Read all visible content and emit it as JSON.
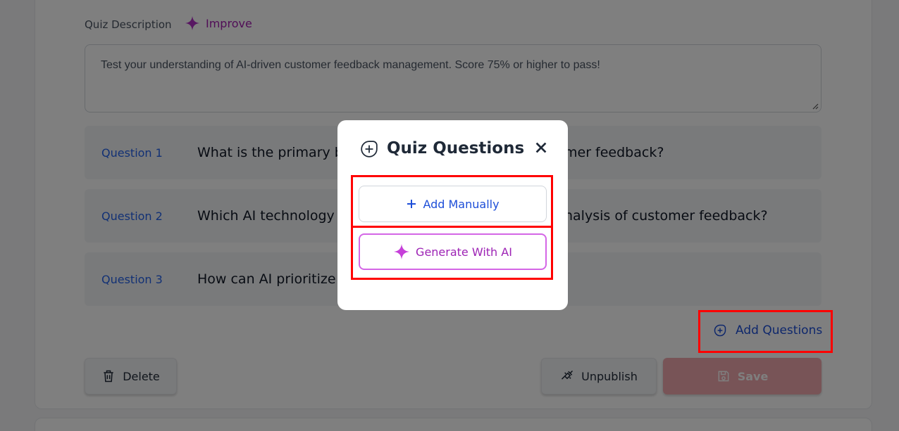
{
  "description": {
    "label": "Quiz Description",
    "improve_label": "Improve",
    "text": "Test your understanding of AI-driven customer feedback management. Score 75% or higher to pass!"
  },
  "questions": [
    {
      "label": "Question 1",
      "text_left": "What is the primary b",
      "text_right": "mer feedback?"
    },
    {
      "label": "Question 2",
      "text_left": "Which AI technology",
      "text_right": "nalysis of customer feedback?"
    },
    {
      "label": "Question 3",
      "text_left": "How can AI prioritize",
      "text_right": ""
    }
  ],
  "add_questions_label": "Add Questions",
  "buttons": {
    "delete": "Delete",
    "unpublish": "Unpublish",
    "save": "Save"
  },
  "modal": {
    "title": "Quiz Questions",
    "add_manually": "Add Manually",
    "generate_ai": "Generate With AI"
  },
  "colors": {
    "accent_blue": "#1d4ed8",
    "ai_purple": "#a21caf",
    "save_disabled": "#f0a8ae",
    "highlight": "#ff0000"
  }
}
